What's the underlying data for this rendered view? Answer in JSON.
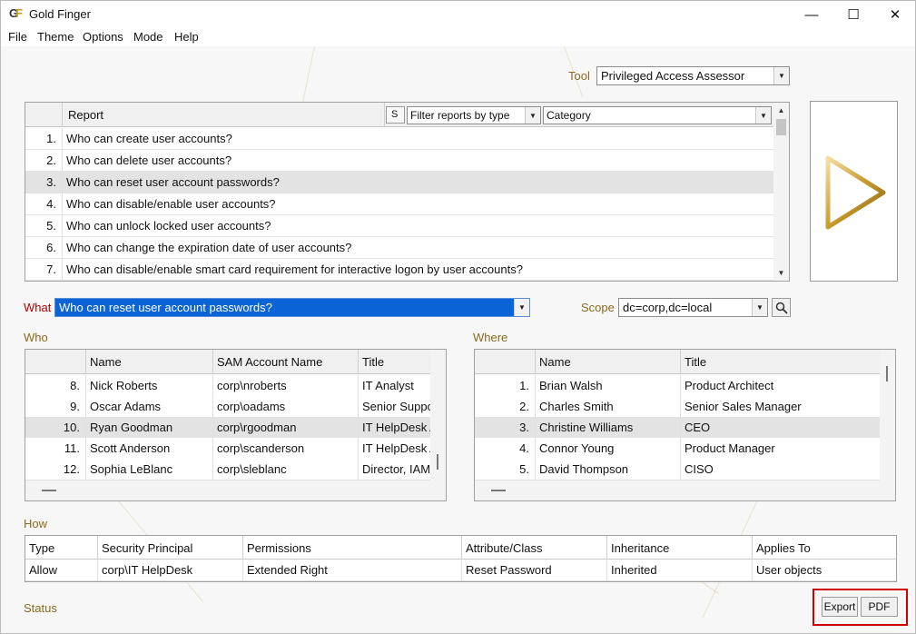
{
  "app": {
    "title": "Gold Finger",
    "logo_text": "GF"
  },
  "window_controls": {
    "minimize": "—",
    "maximize": "☐",
    "close": "✕"
  },
  "menu": [
    "File",
    "Theme",
    "Options",
    "Mode",
    "Help"
  ],
  "tool": {
    "label": "Tool",
    "value": "Privileged Access Assessor"
  },
  "reports": {
    "header": {
      "report": "Report",
      "s_button": "S",
      "filter": "Filter reports by type",
      "category": "Category"
    },
    "rows": [
      {
        "num": "1.",
        "text": "Who can create user accounts?"
      },
      {
        "num": "2.",
        "text": "Who can delete user accounts?"
      },
      {
        "num": "3.",
        "text": "Who can reset user account passwords?"
      },
      {
        "num": "4.",
        "text": "Who can disable/enable user accounts?"
      },
      {
        "num": "5.",
        "text": "Who can unlock locked user accounts?"
      },
      {
        "num": "6.",
        "text": "Who can change the expiration date of user accounts?"
      },
      {
        "num": "7.",
        "text": "Who can disable/enable smart card requirement for interactive logon by user accounts?"
      }
    ]
  },
  "what": {
    "label": "What",
    "value": "Who can reset user account passwords?"
  },
  "scope": {
    "label": "Scope",
    "value": "dc=corp,dc=local"
  },
  "who": {
    "label": "Who",
    "columns": [
      "Name",
      "SAM Account Name",
      "Title"
    ],
    "rows": [
      {
        "num": "8.",
        "name": "Nick Roberts",
        "sam": "corp\\nroberts",
        "title": "IT Analyst"
      },
      {
        "num": "9.",
        "name": "Oscar Adams",
        "sam": "corp\\oadams",
        "title": "Senior Suppo"
      },
      {
        "num": "10.",
        "name": "Ryan Goodman",
        "sam": "corp\\rgoodman",
        "title": "IT HelpDesk A"
      },
      {
        "num": "11.",
        "name": "Scott Anderson",
        "sam": "corp\\scanderson",
        "title": "IT HelpDesk A"
      },
      {
        "num": "12.",
        "name": "Sophia LeBlanc",
        "sam": "corp\\sleblanc",
        "title": "Director, IAM"
      }
    ]
  },
  "where": {
    "label": "Where",
    "columns": [
      "Name",
      "Title"
    ],
    "rows": [
      {
        "num": "1.",
        "name": "Brian Walsh",
        "title": "Product Architect"
      },
      {
        "num": "2.",
        "name": "Charles Smith",
        "title": "Senior Sales Manager"
      },
      {
        "num": "3.",
        "name": "Christine Williams",
        "title": "CEO"
      },
      {
        "num": "4.",
        "name": "Connor Young",
        "title": "Product Manager"
      },
      {
        "num": "5.",
        "name": "David Thompson",
        "title": "CISO"
      }
    ]
  },
  "how": {
    "label": "How",
    "columns": [
      "Type",
      "Security Principal",
      "Permissions",
      "Attribute/Class",
      "Inheritance",
      "Applies To"
    ],
    "rows": [
      [
        "Allow",
        "corp\\IT HelpDesk",
        "Extended Right",
        "Reset Password",
        "Inherited",
        "User objects"
      ]
    ]
  },
  "status": {
    "label": "Status"
  },
  "actions": {
    "export": "Export",
    "pdf": "PDF"
  },
  "colors": {
    "gold": "#c99b2e",
    "highlight_box": "#d00000",
    "selection": "#1a73e8"
  }
}
